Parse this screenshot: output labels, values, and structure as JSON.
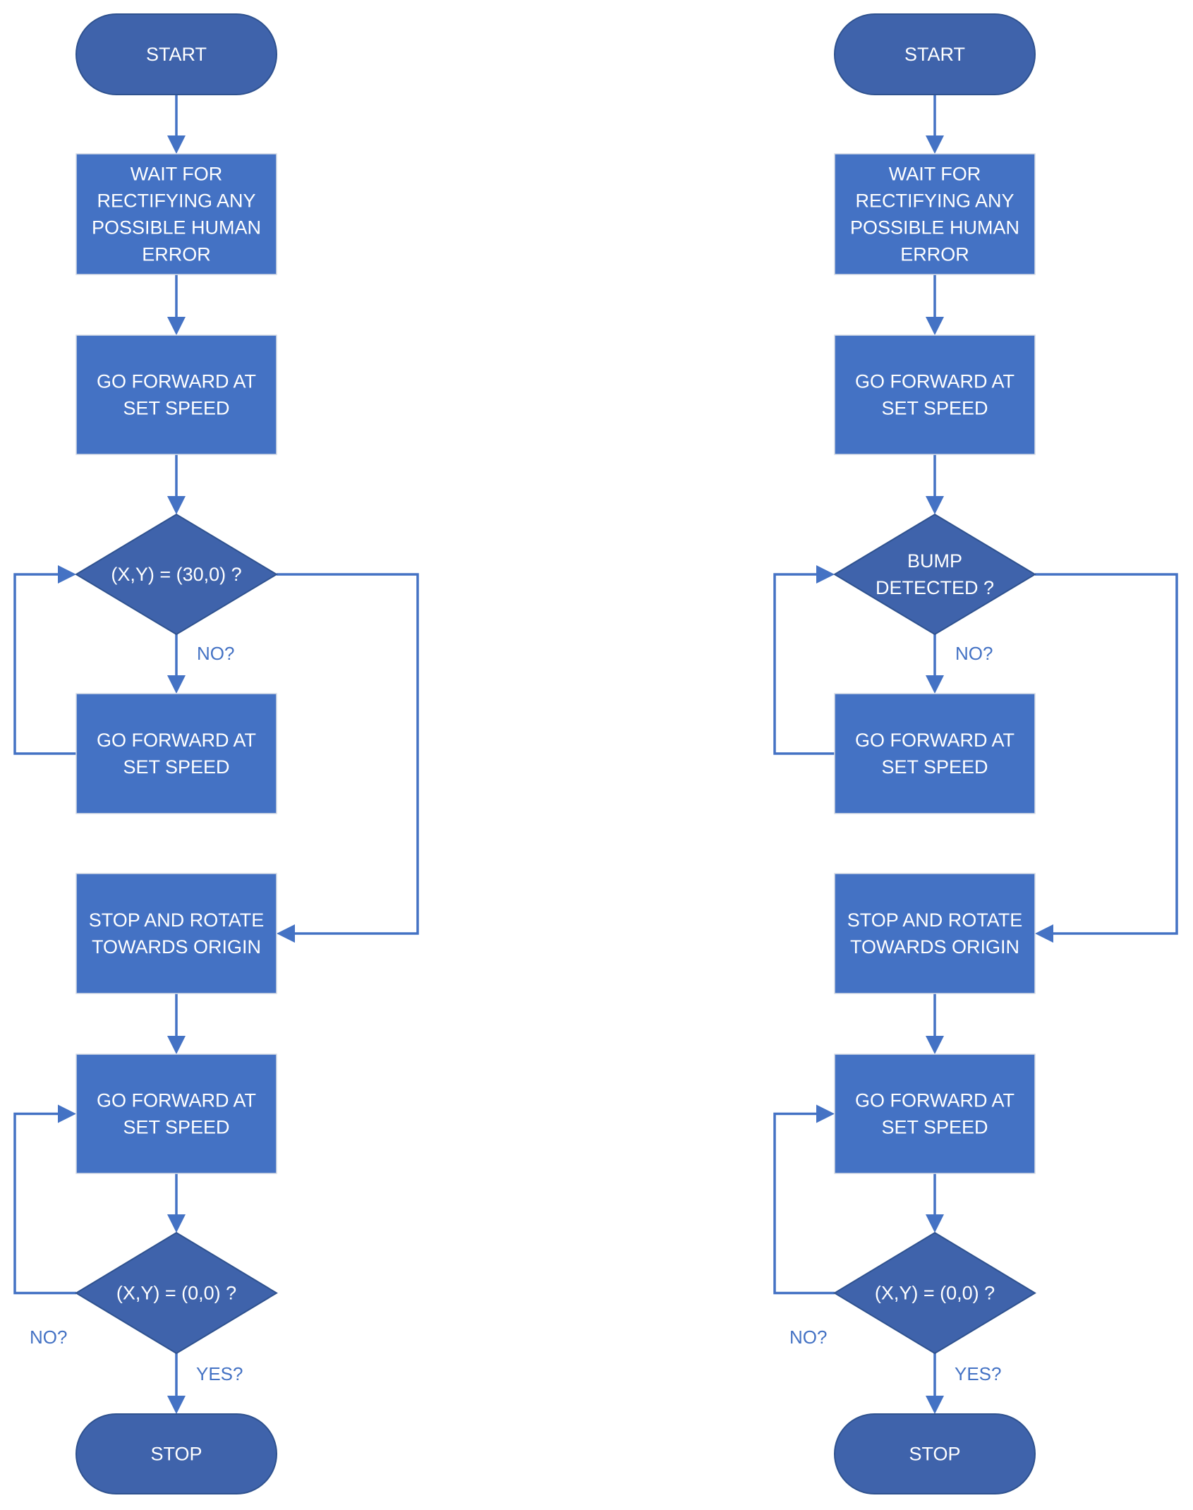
{
  "flowcharts": [
    {
      "id": "left",
      "start": "START",
      "step1": [
        "WAIT FOR",
        "RECTIFYING ANY",
        "POSSIBLE HUMAN",
        "ERROR"
      ],
      "step2": [
        "GO FORWARD AT",
        "SET SPEED"
      ],
      "decision1": [
        "(X,Y) = (30,0) ?"
      ],
      "decision1_no_label": "NO?",
      "step3": [
        "GO FORWARD AT",
        "SET SPEED"
      ],
      "step4": [
        "STOP AND ROTATE",
        "TOWARDS ORIGIN"
      ],
      "step5": [
        "GO FORWARD AT",
        "SET SPEED"
      ],
      "decision2": [
        "(X,Y) = (0,0) ?"
      ],
      "decision2_no_label": "NO?",
      "decision2_yes_label": "YES?",
      "stop": "STOP"
    },
    {
      "id": "right",
      "start": "START",
      "step1": [
        "WAIT FOR",
        "RECTIFYING ANY",
        "POSSIBLE HUMAN",
        "ERROR"
      ],
      "step2": [
        "GO FORWARD AT",
        "SET SPEED"
      ],
      "decision1": [
        "BUMP",
        "DETECTED ?"
      ],
      "decision1_no_label": "NO?",
      "step3": [
        "GO FORWARD AT",
        "SET SPEED"
      ],
      "step4": [
        "STOP AND ROTATE",
        "TOWARDS ORIGIN"
      ],
      "step5": [
        "GO FORWARD AT",
        "SET SPEED"
      ],
      "decision2": [
        "(X,Y) = (0,0) ?"
      ],
      "decision2_no_label": "NO?",
      "decision2_yes_label": "YES?",
      "stop": "STOP"
    }
  ],
  "colors": {
    "process_fill": "#4472C4",
    "terminator_fill": "#3F63AB",
    "decision_fill": "#3F63AB",
    "connector": "#4472C4",
    "label_text": "#4472C4"
  }
}
